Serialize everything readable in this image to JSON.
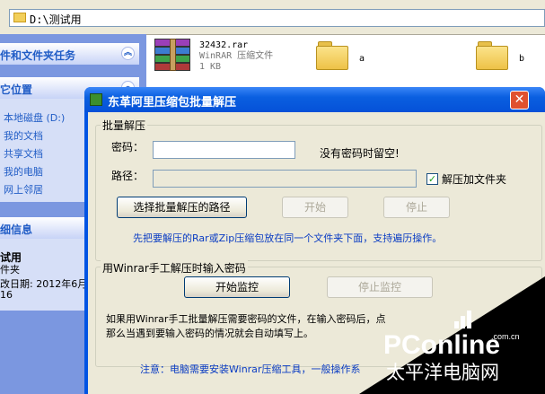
{
  "address_bar": {
    "path": "D:\\测试用"
  },
  "left_pane": {
    "tasks_header": "件和文件夹任务",
    "places_header": "它位置",
    "places": [
      "本地磁盘 (D:)",
      "我的文档",
      "共享文档",
      "我的电脑",
      "网上邻居"
    ],
    "details_header": "细信息",
    "details": {
      "name": "试用",
      "type": "件夹",
      "modified": "改日期: 2012年6月",
      "time": "16"
    }
  },
  "files": [
    {
      "name": "32432.rar",
      "type": "WinRAR 压缩文件",
      "size": "1 KB",
      "icon": "rar-archive-icon"
    },
    {
      "name": "a",
      "icon": "folder-icon"
    },
    {
      "name": "b",
      "icon": "folder-icon"
    }
  ],
  "dialog": {
    "title": "东革阿里压缩包批量解压",
    "batch_group": "批量解压",
    "password_label": "密码：",
    "password_value": "",
    "password_note": "没有密码时留空!",
    "path_label": "路径：",
    "path_value": "",
    "add_folder_label": "解压加文件夹",
    "add_folder_checked": true,
    "select_path_button": "选择批量解压的路径",
    "start_button": "开始",
    "stop_button": "停止",
    "hint1": "先把要解压的Rar或Zip压缩包放在同一个文件夹下面，支持遍历操作。",
    "manual_group": "用Winrar手工解压时输入密码",
    "start_monitor_button": "开始监控",
    "stop_monitor_button": "停止监控",
    "desc_line1": "如果用Winrar手工批量解压需要密码的文件，在输入密码后，点",
    "desc_line2": "那么当遇到要输入密码的情况就会自动填写上。",
    "note": "注意：电脑需要安装Winrar压缩工具，一般操作系"
  },
  "watermark": {
    "brand": "PConline",
    "domain": ".com.cn",
    "tagline": "太平洋电脑网"
  },
  "colors": {
    "xp_blue": "#0054e3",
    "link_blue": "#215dc6",
    "hint_blue": "#0a3cc3"
  }
}
